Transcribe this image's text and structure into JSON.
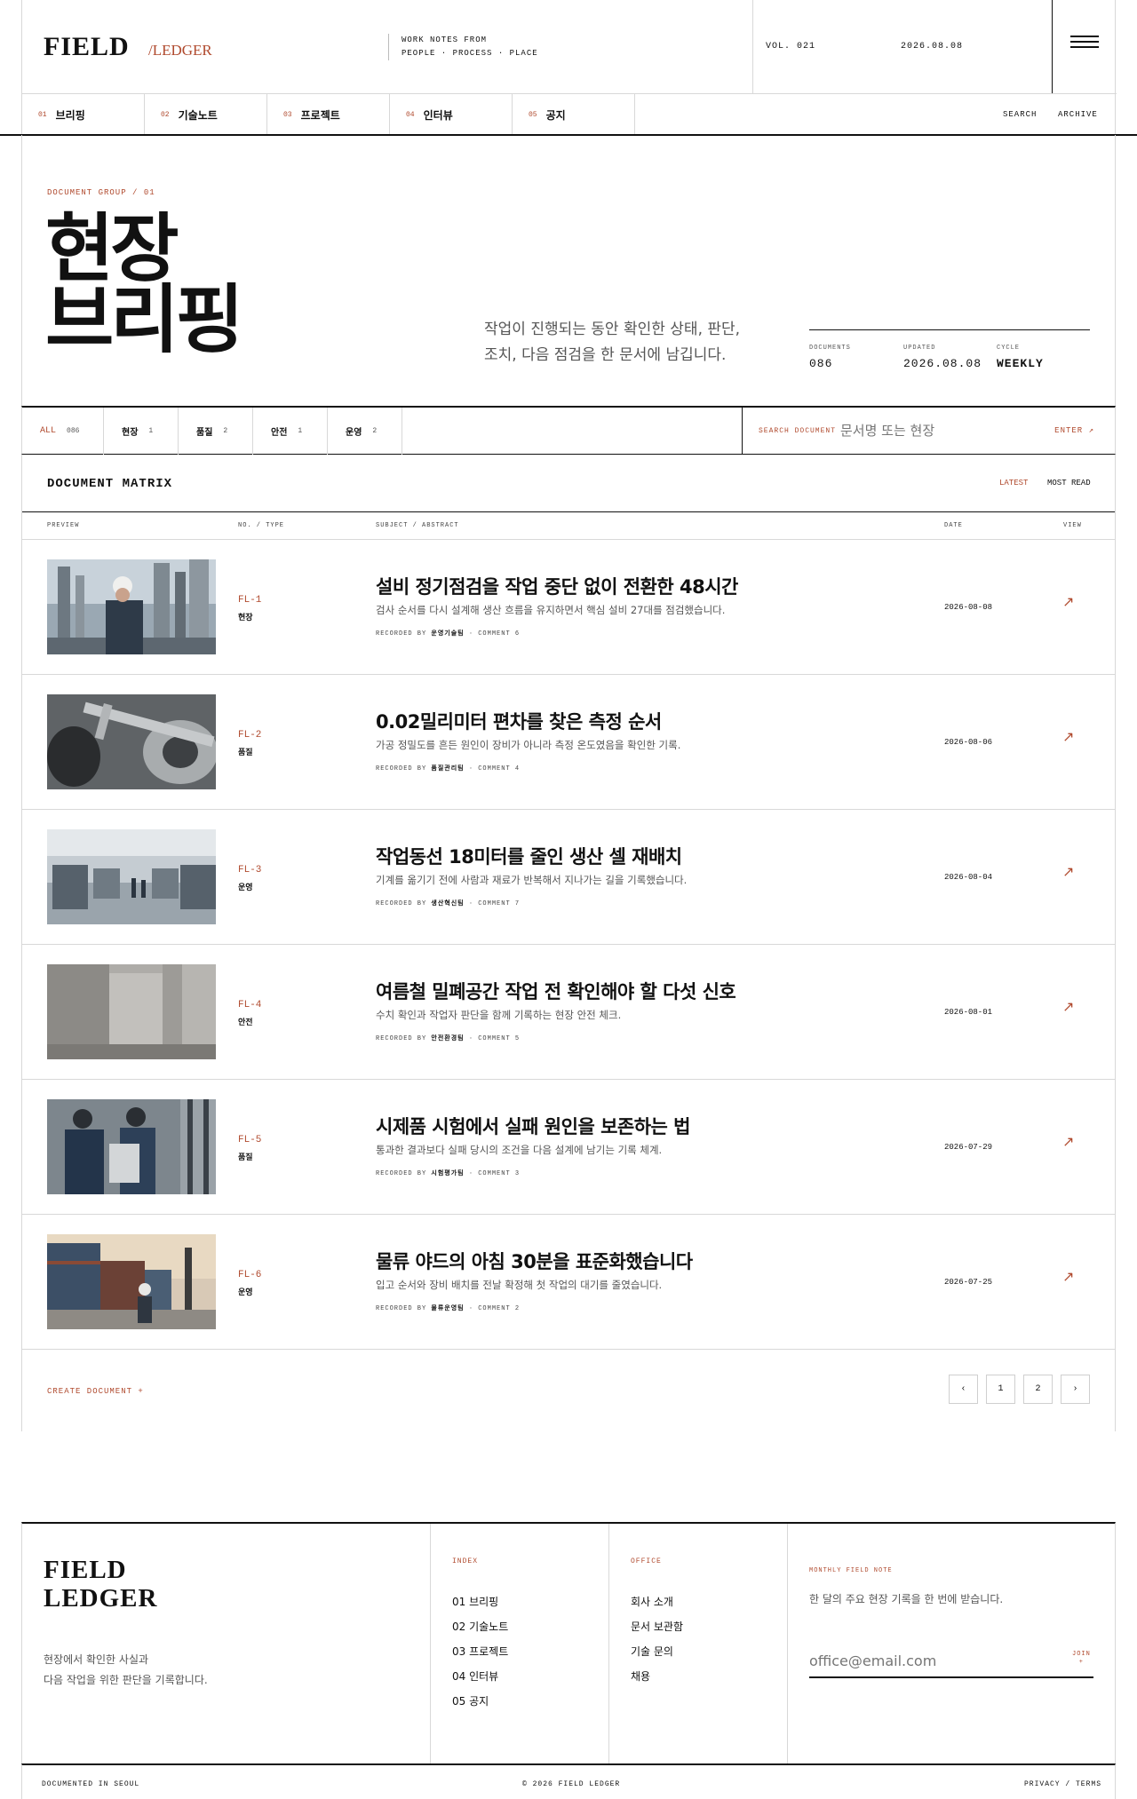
{
  "brand": {
    "logo": "FIELD",
    "logo_sub": "/LEDGER",
    "tagline_1": "WORK NOTES FROM",
    "tagline_2": "PEOPLE · PROCESS · PLACE",
    "volume": "VOL. 021",
    "date": "2026.08.08"
  },
  "nav": {
    "items": [
      {
        "num": "01",
        "label": "브리핑"
      },
      {
        "num": "02",
        "label": "기술노트"
      },
      {
        "num": "03",
        "label": "프로젝트"
      },
      {
        "num": "04",
        "label": "인터뷰"
      },
      {
        "num": "05",
        "label": "공지"
      }
    ],
    "search": "SEARCH",
    "archive": "ARCHIVE"
  },
  "hero": {
    "group": "DOCUMENT GROUP / 01",
    "title_1": "현장",
    "title_2": "브리핑",
    "desc_1": "작업이 진행되는 동안 확인한 상태, 판단,",
    "desc_2": "조치, 다음 점검을 한 문서에 남깁니다.",
    "stats": [
      {
        "label": "DOCUMENTS",
        "value": "086"
      },
      {
        "label": "UPDATED",
        "value": "2026.08.08"
      },
      {
        "label": "CYCLE",
        "value": "WEEKLY"
      }
    ]
  },
  "filters": {
    "chips": [
      {
        "label": "ALL",
        "count": "086"
      },
      {
        "label": "현장",
        "count": "1"
      },
      {
        "label": "품질",
        "count": "2"
      },
      {
        "label": "안전",
        "count": "1"
      },
      {
        "label": "운영",
        "count": "2"
      }
    ],
    "search_label": "SEARCH DOCUMENT",
    "search_placeholder": "문서명 또는 현장",
    "enter": "ENTER ↗"
  },
  "matrix": {
    "title": "DOCUMENT MATRIX",
    "sort_latest": "LATEST",
    "sort_most": "MOST READ",
    "headers": {
      "preview": "PREVIEW",
      "no": "NO. / TYPE",
      "subject": "SUBJECT / ABSTRACT",
      "date": "DATE",
      "view": "VIEW"
    },
    "rows": [
      {
        "code": "FL-1",
        "type": "현장",
        "title": "설비 정기점검을 작업 중단 없이 전환한 48시간",
        "abstract": "검사 순서를 다시 설계해 생산 흐름을 유지하면서 핵심 설비 27대를 점검했습니다.",
        "recorder": "운영기술팀",
        "comments": "COMMENT 6",
        "date": "2026-08-08"
      },
      {
        "code": "FL-2",
        "type": "품질",
        "title": "0.02밀리미터 편차를 찾은 측정 순서",
        "abstract": "가공 정밀도를 흔든 원인이 장비가 아니라 측정 온도였음을 확인한 기록.",
        "recorder": "품질관리팀",
        "comments": "COMMENT 4",
        "date": "2026-08-06"
      },
      {
        "code": "FL-3",
        "type": "운영",
        "title": "작업동선 18미터를 줄인 생산 셀 재배치",
        "abstract": "기계를 옮기기 전에 사람과 재료가 반복해서 지나가는 길을 기록했습니다.",
        "recorder": "생산혁신팀",
        "comments": "COMMENT 7",
        "date": "2026-08-04"
      },
      {
        "code": "FL-4",
        "type": "안전",
        "title": "여름철 밀폐공간 작업 전 확인해야 할 다섯 신호",
        "abstract": "수치 확인과 작업자 판단을 함께 기록하는 현장 안전 체크.",
        "recorder": "안전환경팀",
        "comments": "COMMENT 5",
        "date": "2026-08-01"
      },
      {
        "code": "FL-5",
        "type": "품질",
        "title": "시제품 시험에서 실패 원인을 보존하는 법",
        "abstract": "통과한 결과보다 실패 당시의 조건을 다음 설계에 남기는 기록 체계.",
        "recorder": "시험평가팀",
        "comments": "COMMENT 3",
        "date": "2026-07-29"
      },
      {
        "code": "FL-6",
        "type": "운영",
        "title": "물류 야드의 아침 30분을 표준화했습니다",
        "abstract": "입고 순서와 장비 배치를 전날 확정해 첫 작업의 대기를 줄였습니다.",
        "recorder": "물류운영팀",
        "comments": "COMMENT 2",
        "date": "2026-07-25"
      }
    ],
    "recorded_by": "RECORDED BY",
    "create": "CREATE DOCUMENT +",
    "pager": [
      "‹",
      "1",
      "2",
      "›"
    ]
  },
  "footer": {
    "logo_1": "FIELD",
    "logo_2": "LEDGER",
    "desc_1": "현장에서 확인한 사실과",
    "desc_2": "다음 작업을 위한 판단을 기록합니다.",
    "index_title": "INDEX",
    "index": [
      "01 브리핑",
      "02 기술노트",
      "03 프로젝트",
      "04 인터뷰",
      "05 공지"
    ],
    "office_title": "OFFICE",
    "office": [
      "회사 소개",
      "문서 보관함",
      "기술 문의",
      "채용"
    ],
    "news_title": "MONTHLY FIELD NOTE",
    "news_desc": "한 달의 주요 현장 기록을 한 번에 받습니다.",
    "news_placeholder": "office@email.com",
    "join_1": "JOIN",
    "join_2": "+",
    "bottom_left": "DOCUMENTED IN SEOUL",
    "bottom_center": "© 2026 FIELD LEDGER",
    "bottom_right": "PRIVACY / TERMS"
  },
  "colors": {
    "accent": "#b04a2e",
    "ink": "#111111",
    "rule": "#d8d8d8"
  }
}
